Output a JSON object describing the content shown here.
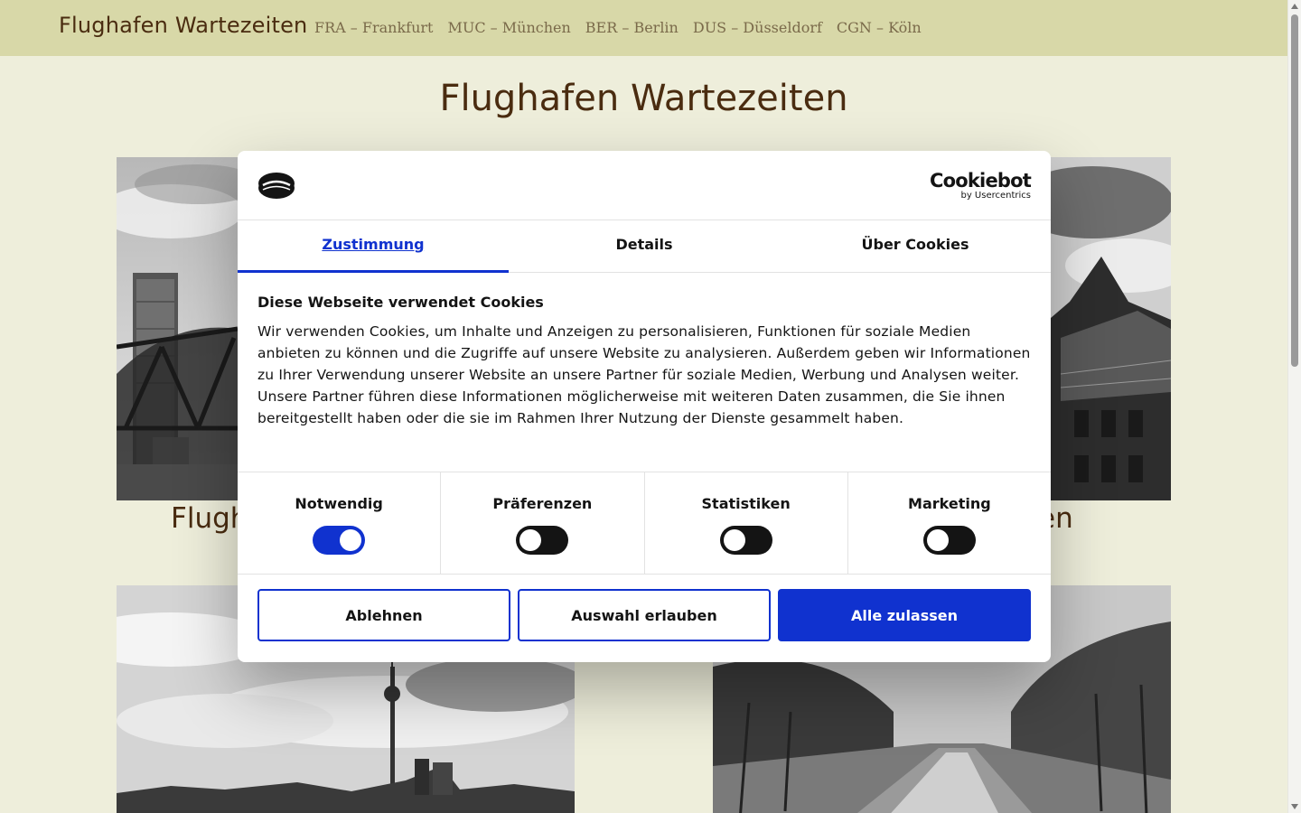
{
  "navbar": {
    "brand": "Flughafen Wartezeiten",
    "links": [
      "FRA – Frankfurt",
      "MUC – München",
      "BER – Berlin",
      "DUS – Düsseldorf",
      "CGN – Köln"
    ]
  },
  "page": {
    "title": "Flughafen Wartezeiten",
    "card_title_left_partial": "Flugh",
    "card_title_right_partial": "en"
  },
  "cookie_dialog": {
    "brand_name": "Cookiebot",
    "brand_sub": "by Usercentrics",
    "tabs": [
      "Zustimmung",
      "Details",
      "Über Cookies"
    ],
    "heading": "Diese Webseite verwendet Cookies",
    "text": "Wir verwenden Cookies, um Inhalte und Anzeigen zu personalisieren, Funktionen für soziale Medien anbieten zu können und die Zugriffe auf unsere Website zu analysieren. Außerdem geben wir Informationen zu Ihrer Verwendung unserer Website an unsere Partner für soziale Medien, Werbung und Analysen weiter. Unsere Partner führen diese Informationen möglicherweise mit weiteren Daten zusammen, die Sie ihnen bereitgestellt haben oder die sie im Rahmen Ihrer Nutzung der Dienste gesammelt haben.",
    "categories": [
      {
        "label": "Notwendig",
        "enabled": true
      },
      {
        "label": "Präferenzen",
        "enabled": false
      },
      {
        "label": "Statistiken",
        "enabled": false
      },
      {
        "label": "Marketing",
        "enabled": false
      }
    ],
    "buttons": {
      "decline": "Ablehnen",
      "allow_selection": "Auswahl erlauben",
      "allow_all": "Alle zulassen"
    }
  },
  "colors": {
    "accent": "#1032cf",
    "navbar_bg": "#d8d8a8",
    "page_bg": "#eeeedb",
    "title_color": "#4a2c10"
  }
}
